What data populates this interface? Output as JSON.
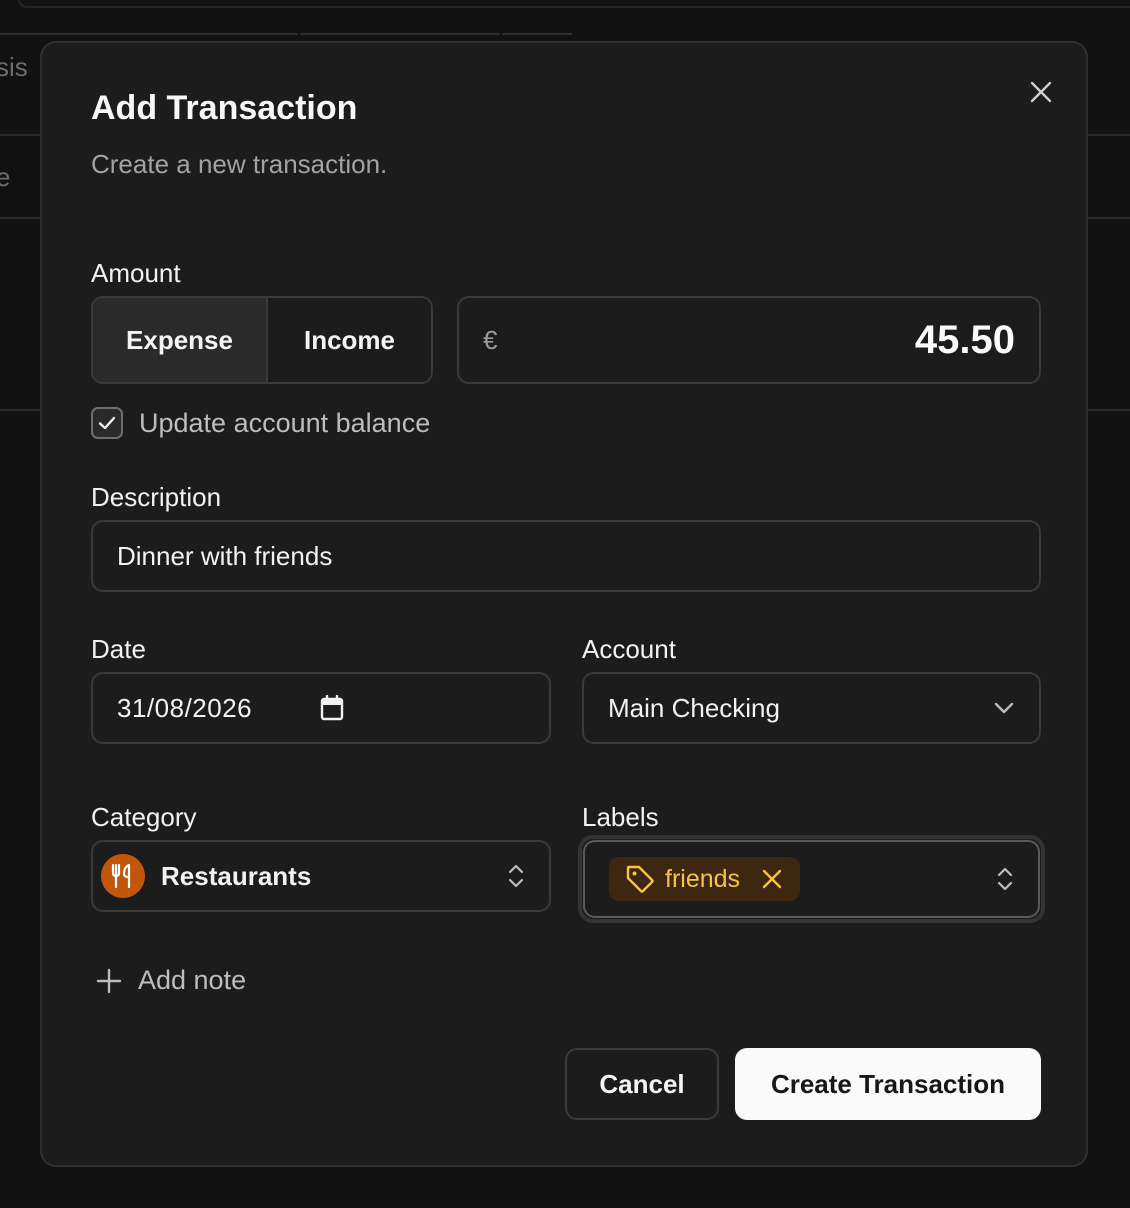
{
  "background": {
    "fragment_top": "sis",
    "fragment_mid": "e"
  },
  "dialog": {
    "title": "Add Transaction",
    "subtitle": "Create a new transaction.",
    "amount": {
      "label": "Amount",
      "type_options": [
        "Expense",
        "Income"
      ],
      "selected_type": "Expense",
      "currency_symbol": "€",
      "value": "45.50"
    },
    "update_balance": {
      "label": "Update account balance",
      "checked": true
    },
    "description": {
      "label": "Description",
      "value": "Dinner with friends"
    },
    "date": {
      "label": "Date",
      "value": "31/08/2026"
    },
    "account": {
      "label": "Account",
      "value": "Main Checking"
    },
    "category": {
      "label": "Category",
      "value": "Restaurants",
      "icon": "fork-knife-icon",
      "icon_color": "#c2560d"
    },
    "labels": {
      "label": "Labels",
      "chips": [
        {
          "text": "friends",
          "color": "#f5c542",
          "bg": "#3d2710"
        }
      ]
    },
    "add_note": "Add note",
    "cancel": "Cancel",
    "create": "Create Transaction"
  }
}
